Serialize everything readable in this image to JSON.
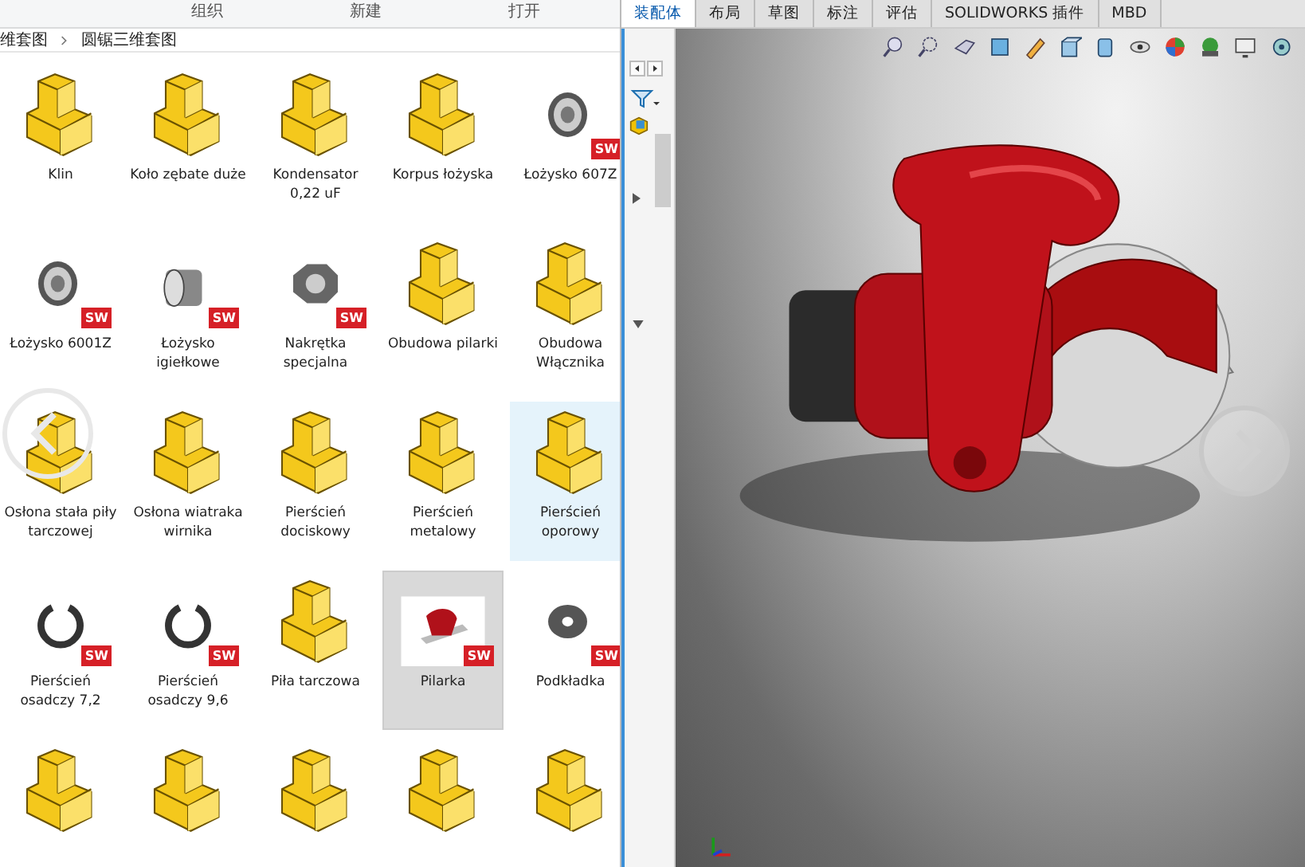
{
  "explorer": {
    "ribbon_groups": [
      "组织",
      "新建",
      "打开"
    ],
    "breadcrumb": [
      "维套图",
      "圆锯三维套图"
    ],
    "files": [
      {
        "kind": "part",
        "label": "Klin",
        "selected": false,
        "hovered": false
      },
      {
        "kind": "part",
        "label": "Koło zębate duże",
        "selected": false,
        "hovered": false
      },
      {
        "kind": "part",
        "label": "Kondensator 0,22 uF",
        "selected": false,
        "hovered": false
      },
      {
        "kind": "part",
        "label": "Korpus łożyska",
        "selected": false,
        "hovered": false
      },
      {
        "kind": "bearing",
        "label": "Łożysko 607Z",
        "badge": "SW",
        "selected": false,
        "hovered": false
      },
      {
        "kind": "bearing",
        "label": "Łożysko 6001Z",
        "badge": "SW",
        "selected": false,
        "hovered": false
      },
      {
        "kind": "sleeve",
        "label": "Łożysko igiełkowe",
        "badge": "SW",
        "selected": false,
        "hovered": false
      },
      {
        "kind": "nut",
        "label": "Nakrętka specjalna",
        "badge": "SW",
        "selected": false,
        "hovered": false
      },
      {
        "kind": "part",
        "label": "Obudowa pilarki",
        "selected": false,
        "hovered": false
      },
      {
        "kind": "part",
        "label": "Obudowa Włącznika",
        "selected": false,
        "hovered": false
      },
      {
        "kind": "part",
        "label": "Osłona stała piły tarczowej",
        "selected": false,
        "hovered": false
      },
      {
        "kind": "part",
        "label": "Osłona wiatraka wirnika",
        "selected": false,
        "hovered": false
      },
      {
        "kind": "part",
        "label": "Pierścień dociskowy",
        "selected": false,
        "hovered": false
      },
      {
        "kind": "part",
        "label": "Pierścień metalowy",
        "selected": false,
        "hovered": false
      },
      {
        "kind": "part",
        "label": "Pierścień oporowy",
        "selected": false,
        "hovered": true
      },
      {
        "kind": "clip",
        "label": "Pierścień osadczy 7,2",
        "badge": "SW",
        "selected": false,
        "hovered": false
      },
      {
        "kind": "clip",
        "label": "Pierścień osadczy 9,6",
        "badge": "SW",
        "selected": false,
        "hovered": false
      },
      {
        "kind": "part",
        "label": "Piła tarczowa",
        "selected": false,
        "hovered": false
      },
      {
        "kind": "assembly",
        "label": "Pilarka",
        "badge": "SW",
        "selected": true,
        "hovered": false
      },
      {
        "kind": "washer",
        "label": "Podkładka",
        "badge": "SW",
        "selected": false,
        "hovered": false
      },
      {
        "kind": "part",
        "selected": false,
        "hovered": false
      },
      {
        "kind": "part",
        "selected": false,
        "hovered": false
      },
      {
        "kind": "part",
        "selected": false,
        "hovered": false
      },
      {
        "kind": "part",
        "selected": false,
        "hovered": false
      },
      {
        "kind": "part",
        "selected": false,
        "hovered": false
      }
    ]
  },
  "cad": {
    "tabs": [
      {
        "label": "装配体",
        "selected": true
      },
      {
        "label": "布局",
        "selected": false
      },
      {
        "label": "草图",
        "selected": false
      },
      {
        "label": "标注",
        "selected": false
      },
      {
        "label": "评估",
        "selected": false
      },
      {
        "label": "SOLIDWORKS 插件",
        "selected": false
      },
      {
        "label": "MBD",
        "selected": false
      }
    ]
  }
}
